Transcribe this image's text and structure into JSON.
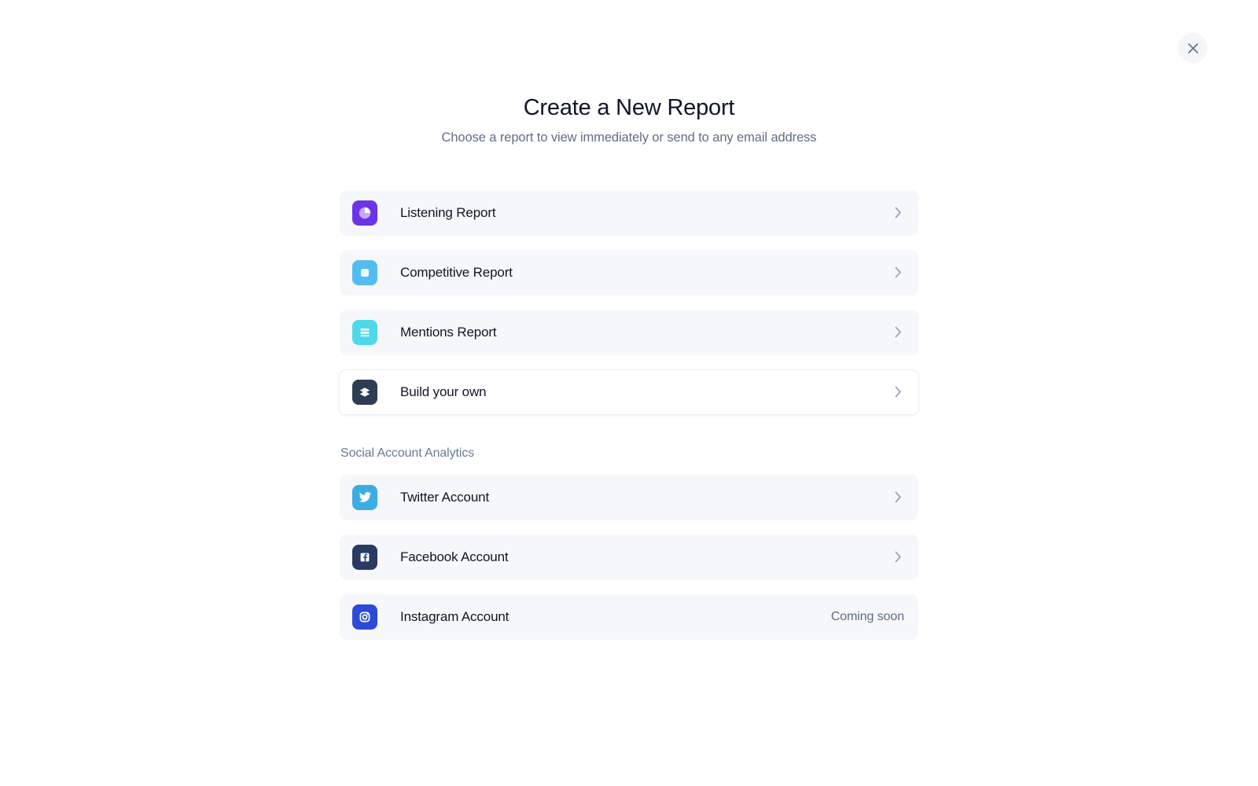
{
  "window": {
    "close_label": "Close",
    "close_icon": "close-icon"
  },
  "header": {
    "title": "Create a New Report",
    "subtitle": "Choose a report to view immediately or send to any email address"
  },
  "reports": {
    "items": [
      {
        "label": "Listening Report",
        "icon": "listening-pie-icon",
        "icon_color": "#6c34e8",
        "style": "filled",
        "chevron": "chevron-right-icon",
        "note": ""
      },
      {
        "label": "Competitive Report",
        "icon": "competitive-square-icon",
        "icon_color": "#54bdf0",
        "style": "filled",
        "chevron": "chevron-right-icon",
        "note": ""
      },
      {
        "label": "Mentions Report",
        "icon": "mentions-list-icon",
        "icon_color": "#4fd9e8",
        "style": "filled",
        "chevron": "chevron-right-icon",
        "note": ""
      },
      {
        "label": "Build your own",
        "icon": "layers-stack-icon",
        "icon_color": "#2c3e53",
        "style": "outlined",
        "chevron": "chevron-right-icon",
        "note": ""
      }
    ]
  },
  "social_section": {
    "heading": "Social Account Analytics",
    "items": [
      {
        "label": "Twitter Account",
        "icon": "twitter-bird-icon",
        "icon_color": "#3bade3",
        "style": "filled",
        "chevron": "chevron-right-icon",
        "note": ""
      },
      {
        "label": "Facebook Account",
        "icon": "facebook-f-icon",
        "icon_color": "#2b3a63",
        "style": "filled",
        "chevron": "chevron-right-icon",
        "note": ""
      },
      {
        "label": "Instagram Account",
        "icon": "instagram-camera-icon",
        "icon_color": "#2c4ad6",
        "style": "filled",
        "chevron": "",
        "note": "Coming soon"
      }
    ]
  },
  "colors": {
    "row_background": "#f5f7fa",
    "text_primary": "#101628",
    "text_muted": "#606e85",
    "close_button_background": "#f4f6f9"
  }
}
